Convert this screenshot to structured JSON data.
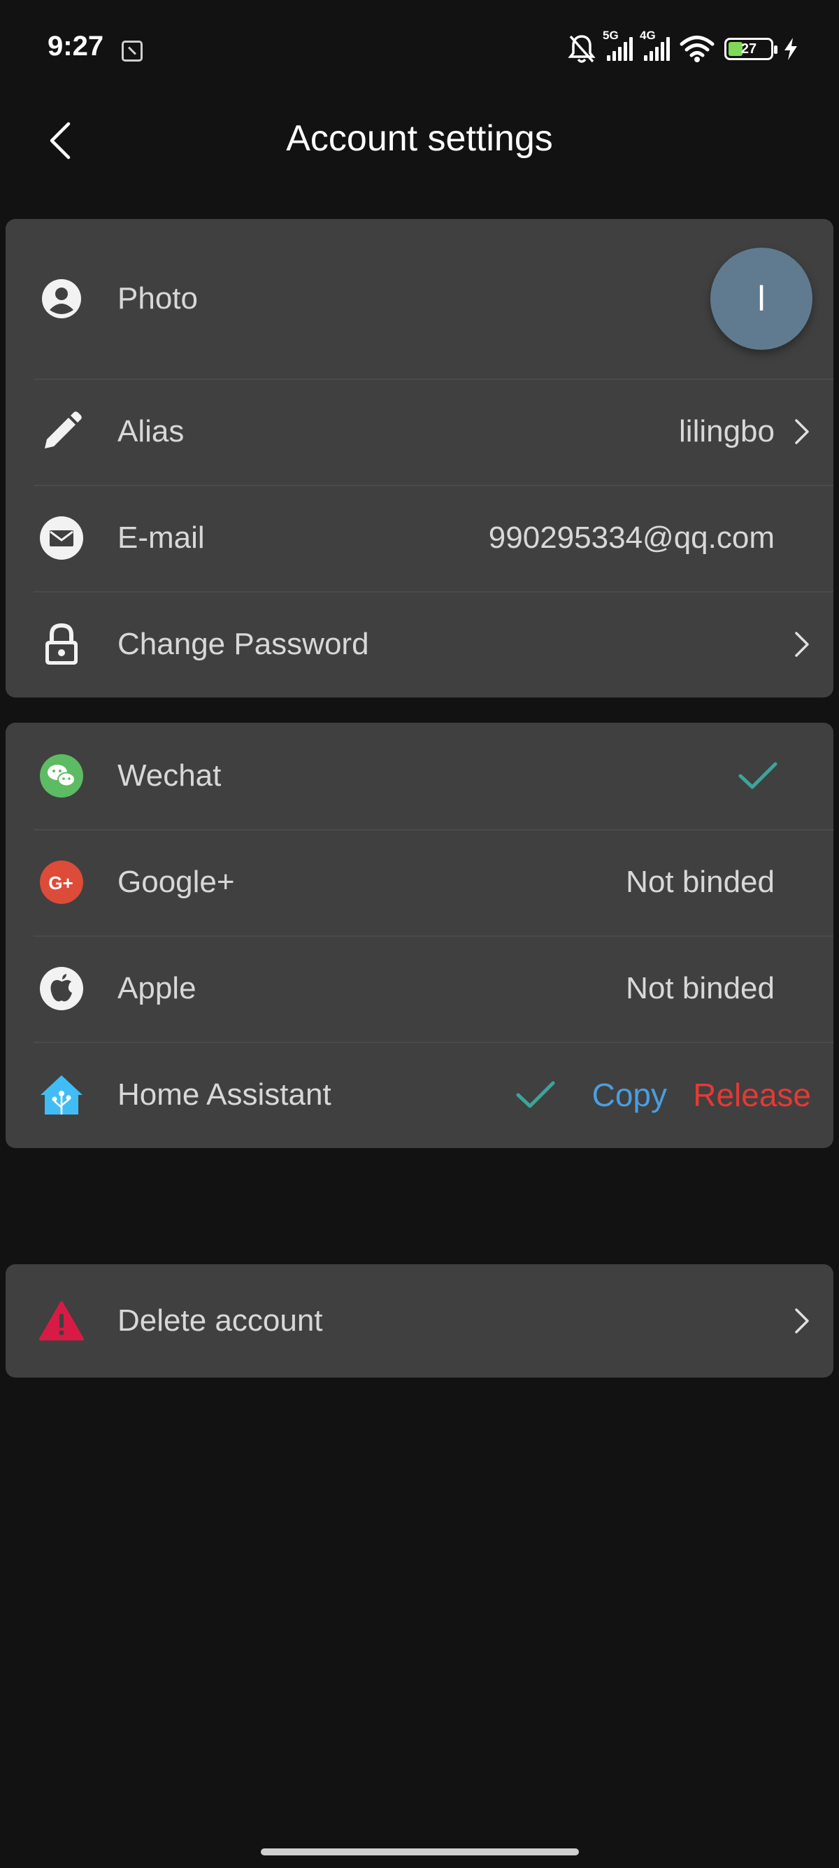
{
  "status_bar": {
    "time": "9:27",
    "signal_5g_label": "5G",
    "signal_4g_label": "4G",
    "battery_percent": "27",
    "icons": [
      "note-icon",
      "mute-icon",
      "signal-icon",
      "wifi-icon",
      "battery-icon",
      "charging-icon"
    ]
  },
  "header": {
    "title": "Account settings",
    "back_icon": "chevron-left-icon"
  },
  "profile": {
    "photo_label": "Photo",
    "avatar_letter": "l",
    "alias_label": "Alias",
    "alias_value": "lilingbo",
    "email_label": "E-mail",
    "email_value": "990295334@qq.com",
    "password_label": "Change Password"
  },
  "bindings": {
    "wechat_label": "Wechat",
    "wechat_status": "bound",
    "google_label": "Google+",
    "google_value": "Not binded",
    "apple_label": "Apple",
    "apple_value": "Not binded",
    "home_assistant_label": "Home Assistant",
    "home_assistant_status": "bound",
    "copy_label": "Copy",
    "release_label": "Release"
  },
  "danger": {
    "delete_label": "Delete account"
  },
  "colors": {
    "background": "#121212",
    "card": "#404040",
    "check": "#3ba59a",
    "link_blue": "#4a9ee0",
    "link_red": "#e53935",
    "avatar": "#607b8f",
    "wechat_green": "#5dbb63",
    "google_red": "#dd4b39",
    "warning_red": "#d81b44",
    "home_assistant_blue": "#41bdf5"
  }
}
